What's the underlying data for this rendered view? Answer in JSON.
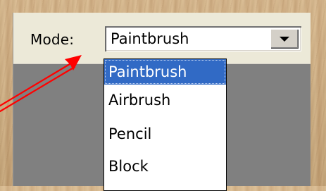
{
  "mode": {
    "label": "Mode:",
    "selected_value": "Paintbrush",
    "options": [
      "Paintbrush",
      "Airbrush",
      "Pencil",
      "Block"
    ],
    "highlighted_index": 0
  },
  "colors": {
    "highlight": "#316ac5",
    "arrow": "#ff0000",
    "panel_gray": "#808080",
    "toolbar_bg": "#ece9d8"
  },
  "icons": {
    "dropdown_toggle": "chevron-down-icon",
    "annotation": "arrow-icon"
  }
}
